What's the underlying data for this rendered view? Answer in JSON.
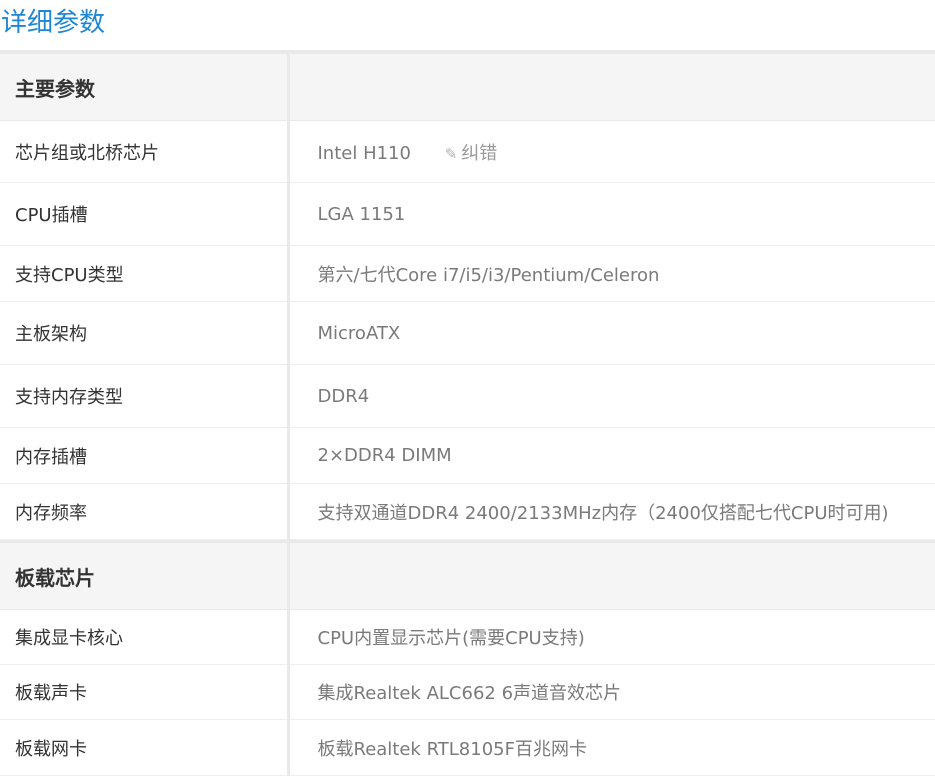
{
  "page": {
    "title": "详细参数"
  },
  "sections": [
    {
      "title": "主要参数",
      "rows": [
        {
          "label": "芯片组或北桥芯片",
          "value": "Intel H110",
          "correct_label": "纠错"
        },
        {
          "label": "CPU插槽",
          "value": "LGA 1151"
        },
        {
          "label": "支持CPU类型",
          "value": "第六/七代Core i7/i5/i3/Pentium/Celeron"
        },
        {
          "label": "主板架构",
          "value": "MicroATX"
        },
        {
          "label": "支持内存类型",
          "value": "DDR4"
        },
        {
          "label": "内存插槽",
          "value": "2×DDR4 DIMM"
        },
        {
          "label": "内存频率",
          "value": "支持双通道DDR4 2400/2133MHz内存（2400仅搭配七代CPU时可用)"
        }
      ]
    },
    {
      "title": "板载芯片",
      "rows": [
        {
          "label": "集成显卡核心",
          "value": "CPU内置显示芯片(需要CPU支持)"
        },
        {
          "label": "板载声卡",
          "value": "集成Realtek ALC662 6声道音效芯片"
        },
        {
          "label": "板载网卡",
          "value": "板载Realtek RTL8105F百兆网卡"
        }
      ]
    }
  ]
}
